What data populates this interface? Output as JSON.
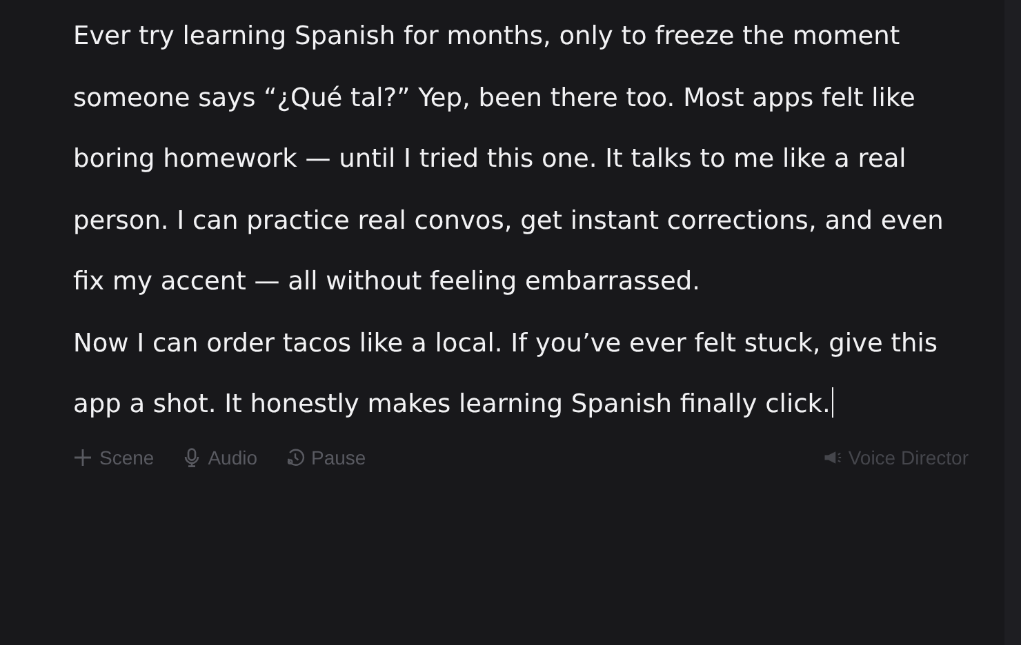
{
  "paragraphs": [
    "Ever try learning Spanish for months, only to freeze the moment someone says “¿Qué tal?” Yep, been there too. Most apps felt like boring homework — until I tried this one. It talks to me like a real person. I can practice real convos, get instant corrections, and even fix my accent — all without feeling embarrassed.",
    "Now I can order tacos like a local. If you’ve ever felt stuck, give this app a shot. It honestly makes learning Spanish finally click."
  ],
  "toolbar": [
    {
      "kind": "scene",
      "label": "Scene"
    },
    {
      "kind": "audio",
      "label": "Audio"
    },
    {
      "kind": "pause",
      "label": "Pause"
    }
  ],
  "voice_director": {
    "label": "Voice Director"
  }
}
